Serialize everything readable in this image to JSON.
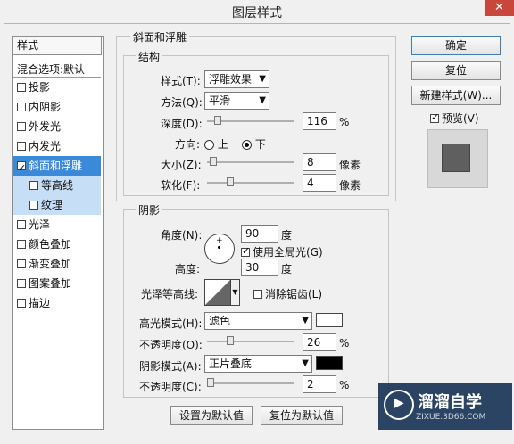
{
  "window": {
    "title": "图层样式",
    "close": "✕"
  },
  "left_list": {
    "header": "样式",
    "blend_default": "混合选项:默认",
    "items": [
      {
        "label": "投影",
        "checked": false
      },
      {
        "label": "内阴影",
        "checked": false
      },
      {
        "label": "外发光",
        "checked": false
      },
      {
        "label": "内发光",
        "checked": false
      },
      {
        "label": "斜面和浮雕",
        "checked": true
      },
      {
        "label": "等高线",
        "checked": false
      },
      {
        "label": "纹理",
        "checked": false
      },
      {
        "label": "光泽",
        "checked": false
      },
      {
        "label": "颜色叠加",
        "checked": false
      },
      {
        "label": "渐变叠加",
        "checked": false
      },
      {
        "label": "图案叠加",
        "checked": false
      },
      {
        "label": "描边",
        "checked": false
      }
    ]
  },
  "bevel": {
    "title": "斜面和浮雕",
    "structure": "结构",
    "style_label": "样式(T):",
    "style_value": "浮雕效果",
    "technique_label": "方法(Q):",
    "technique_value": "平滑",
    "depth_label": "深度(D):",
    "depth_value": "116",
    "depth_unit": "%",
    "direction_label": "方向:",
    "up": "上",
    "down": "下",
    "size_label": "大小(Z):",
    "size_value": "8",
    "size_unit": "像素",
    "soften_label": "软化(F):",
    "soften_value": "4",
    "soften_unit": "像素"
  },
  "shading": {
    "title": "阴影",
    "angle_label": "角度(N):",
    "angle_value": "90",
    "angle_unit": "度",
    "global_light": "使用全局光(G)",
    "altitude_label": "高度:",
    "altitude_value": "30",
    "altitude_unit": "度",
    "gloss_label": "光泽等高线:",
    "antialias": "消除锯齿(L)",
    "highlight_label": "高光模式(H):",
    "highlight_value": "滤色",
    "highlight_opacity_label": "不透明度(O):",
    "highlight_opacity_value": "26",
    "pct": "%",
    "shadow_label": "阴影模式(A):",
    "shadow_value": "正片叠底",
    "shadow_opacity_label": "不透明度(C):",
    "shadow_opacity_value": "2"
  },
  "buttons": {
    "ok": "确定",
    "reset": "复位",
    "new_style": "新建样式(W)...",
    "preview": "预览(V)",
    "make_default": "设置为默认值",
    "reset_default": "复位为默认值"
  },
  "colors": {
    "highlight": "#ffffff",
    "shadow": "#000000",
    "selected": "#3b8ad9"
  },
  "watermark": {
    "name": "溜溜自学",
    "url": "ZIXUE.3D66.COM"
  }
}
